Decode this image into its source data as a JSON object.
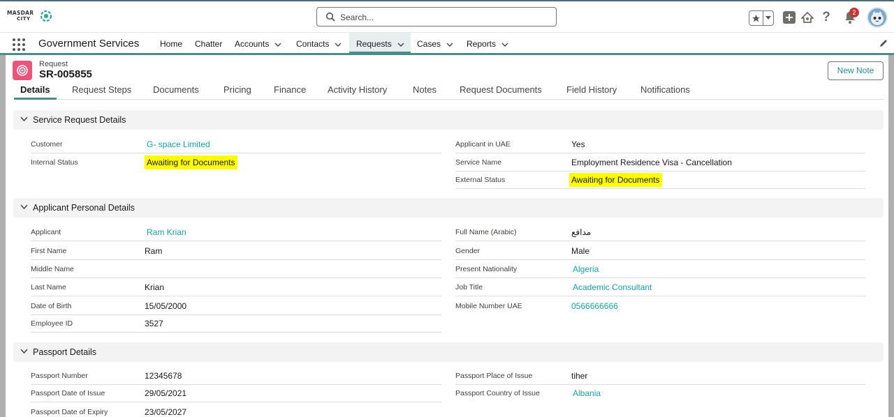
{
  "header": {
    "logo_line1": "MASDAR",
    "logo_line2": "CITY",
    "search_placeholder": "Search...",
    "notification_count": "2",
    "icons": [
      "favorites-star-icon",
      "chevron-down-icon",
      "add-icon",
      "trailhead-icon",
      "help-icon",
      "bell-icon",
      "avatar"
    ]
  },
  "nav": {
    "app_name": "Government Services",
    "items": [
      {
        "label": "Home",
        "dropdown": false
      },
      {
        "label": "Chatter",
        "dropdown": false
      },
      {
        "label": "Accounts",
        "dropdown": true
      },
      {
        "label": "Contacts",
        "dropdown": true
      },
      {
        "label": "Requests",
        "dropdown": true,
        "active": true
      },
      {
        "label": "Cases",
        "dropdown": true
      },
      {
        "label": "Reports",
        "dropdown": true
      }
    ]
  },
  "record": {
    "type": "Request",
    "name": "SR-005855",
    "new_note_label": "New Note"
  },
  "tabs": [
    "Details",
    "Request Steps",
    "Documents",
    "Pricing",
    "Finance",
    "Activity History",
    "Notes",
    "Request Documents",
    "Field History",
    "Notifications"
  ],
  "sections": {
    "service": {
      "title": "Service Request Details",
      "left": [
        {
          "label": "Customer",
          "value": "G- space Limited"
        },
        {
          "label": "Internal Status",
          "value": "Awaiting for Documents"
        }
      ],
      "right": [
        {
          "label": "Applicant in UAE",
          "value": "Yes"
        },
        {
          "label": "Service Name",
          "value": "Employment Residence Visa - Cancellation"
        },
        {
          "label": "External Status",
          "value": "Awaiting for Documents"
        }
      ]
    },
    "applicant": {
      "title": "Applicant Personal Details",
      "left": [
        {
          "label": "Applicant",
          "value": "Ram Krian"
        },
        {
          "label": "First Name",
          "value": "Ram"
        },
        {
          "label": "Middle Name",
          "value": ""
        },
        {
          "label": "Last Name",
          "value": "Krian"
        },
        {
          "label": "Date of Birth",
          "value": "15/05/2000"
        },
        {
          "label": "Employee ID",
          "value": "3527"
        }
      ],
      "right": [
        {
          "label": "Full Name (Arabic)",
          "value": "مدافع"
        },
        {
          "label": "Gender",
          "value": "Male"
        },
        {
          "label": "Present Nationality",
          "value": "Algeria"
        },
        {
          "label": "Job Title",
          "value": "Academic Consultant"
        },
        {
          "label": "Mobile Number UAE",
          "value": "0566666666"
        }
      ]
    },
    "passport": {
      "title": "Passport Details",
      "left": [
        {
          "label": "Passport Number",
          "value": "12345678"
        },
        {
          "label": "Passport Date of Issue",
          "value": "29/05/2021"
        },
        {
          "label": "Passport Date of Expiry",
          "value": "23/05/2027"
        }
      ],
      "right": [
        {
          "label": "Passport Place of Issue",
          "value": "tiher"
        },
        {
          "label": "Passport Country of Issue",
          "value": "Albania"
        }
      ]
    }
  },
  "colors": {
    "link": "#1b9fa8",
    "highlight": "#ffff00",
    "accent": "#4a8c8c",
    "record_icon": "#e8557a"
  }
}
